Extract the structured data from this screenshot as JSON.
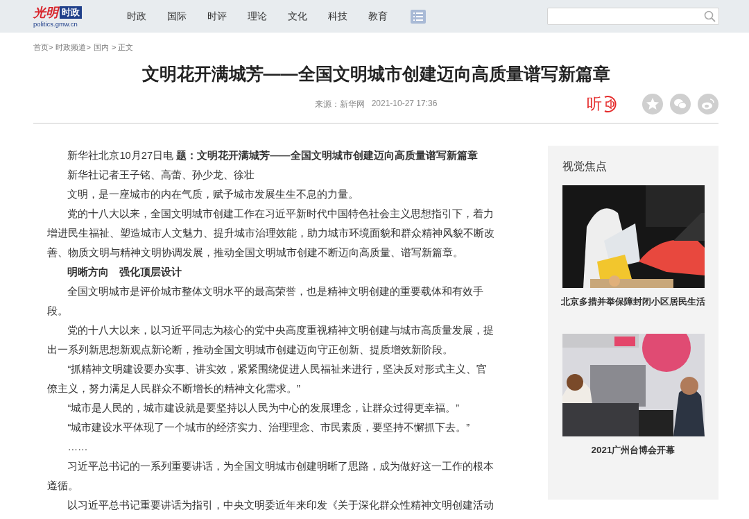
{
  "header": {
    "logo": {
      "mark": "光明",
      "channel": "时政",
      "domain": "politics.gmw.cn"
    },
    "nav": [
      "时政",
      "国际",
      "时评",
      "理论",
      "文化",
      "科技",
      "教育"
    ]
  },
  "breadcrumb": [
    "首页>",
    "时政频道>",
    "国内",
    "> 正文"
  ],
  "article": {
    "title": "文明花开满城芳——全国文明城市创建迈向高质量谱写新篇章",
    "source": "来源：新华网",
    "time": "2021-10-27 17:36",
    "listen_label": "听",
    "paragraphs": [
      {
        "kind": "text",
        "text": "新华社北京10月27日电 **题：文明花开满城芳——全国文明城市创建迈向高质量谱写新篇章**"
      },
      {
        "kind": "text",
        "text": "新华社记者王子铭、高蕾、孙少龙、徐壮"
      },
      {
        "kind": "text",
        "text": "文明，是一座城市的内在气质，赋予城市发展生生不息的力量。"
      },
      {
        "kind": "text",
        "text": "党的十八大以来，全国文明城市创建工作在习近平新时代中国特色社会主义思想指引下，着力增进民生福祉、塑造城市人文魅力、提升城市治理效能，助力城市环境面貌和群众精神风貌不断改善、物质文明与精神文明协调发展，推动全国文明城市创建不断迈向高质量、谱写新篇章。"
      },
      {
        "kind": "heading",
        "text": "明晰方向　强化顶层设计"
      },
      {
        "kind": "text",
        "text": "全国文明城市是评价城市整体文明水平的最高荣誉，也是精神文明创建的重要载体和有效手段。"
      },
      {
        "kind": "text",
        "text": "党的十八大以来，以习近平同志为核心的党中央高度重视精神文明创建与城市高质量发展，提出一系列新思想新观点新论断，推动全国文明城市创建迈向守正创新、提质增效新阶段。"
      },
      {
        "kind": "text",
        "text": "“抓精神文明建设要办实事、讲实效，紧紧围绕促进人民福祉来进行，坚决反对形式主义、官僚主义，努力满足人民群众不断增长的精神文化需求。”"
      },
      {
        "kind": "text",
        "text": "“城市是人民的，城市建设就是要坚持以人民为中心的发展理念，让群众过得更幸福。”"
      },
      {
        "kind": "text",
        "text": "“城市建设水平体现了一个城市的经济实力、治理理念、市民素质，要坚持不懈抓下去。”"
      },
      {
        "kind": "text",
        "text": "……"
      },
      {
        "kind": "text",
        "text": "习近平总书记的一系列重要讲话，为全国文明城市创建明晰了思路，成为做好这一工作的根本遵循。"
      },
      {
        "kind": "text",
        "text": "以习近平总书记重要讲话为指引，中央文明委近年来印发《关于深化群众性精神文明创建活动"
      }
    ]
  },
  "sidebar": {
    "title": "视觉焦点",
    "items": [
      {
        "kind": "picture",
        "caption": "北京多措并举保障封闭小区居民生活"
      },
      {
        "kind": "picture",
        "caption": "2021广州台博会开幕"
      }
    ]
  }
}
